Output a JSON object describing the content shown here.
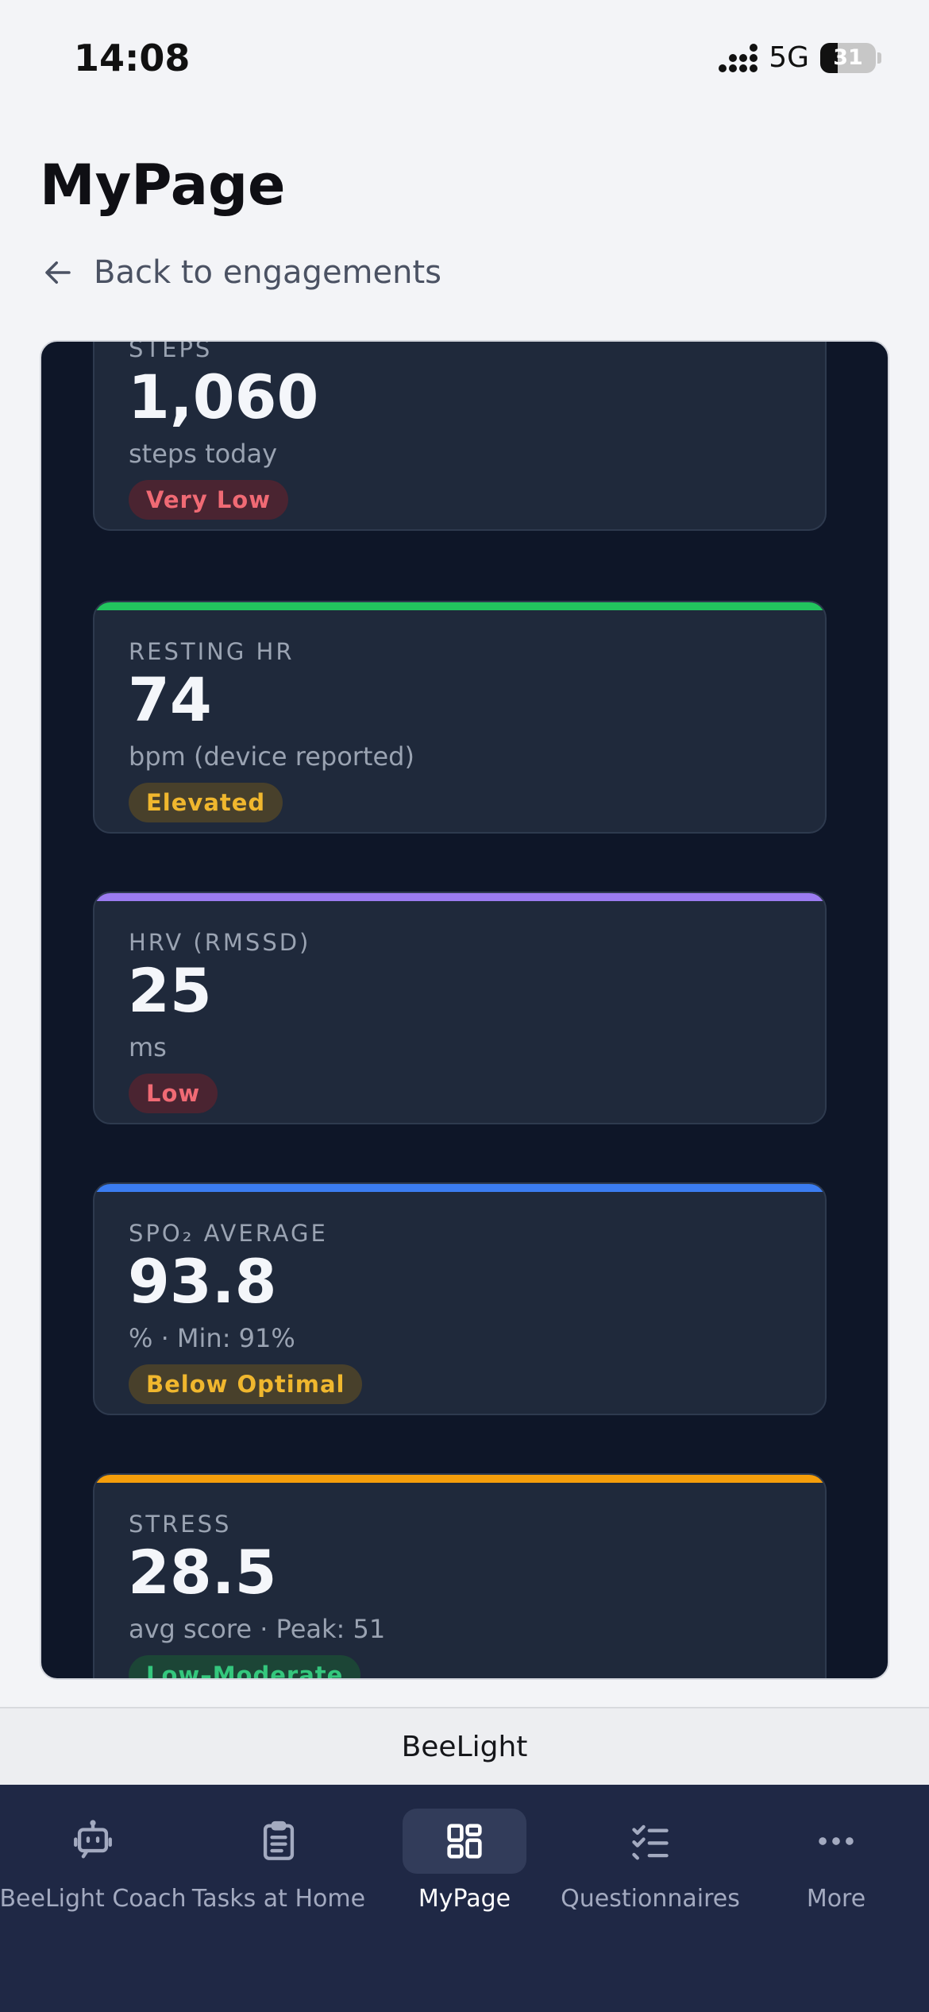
{
  "status_bar": {
    "time": "14:08",
    "network": "5G",
    "battery": "31"
  },
  "page": {
    "title": "MyPage",
    "back_label": "Back to engagements"
  },
  "colors": {
    "steps": "#22c55e",
    "resting_hr": "#22c55e",
    "hrv": "#9b7cf0",
    "spo2": "#3b7cf0",
    "stress": "#f59e0b"
  },
  "metrics": [
    {
      "label": "STEPS",
      "value": "1,060",
      "sub": "steps today",
      "badge": "Very Low",
      "badge_tone": "red"
    },
    {
      "label": "RESTING HR",
      "value": "74",
      "sub": "bpm (device reported)",
      "badge": "Elevated",
      "badge_tone": "amber"
    },
    {
      "label": "HRV (RMSSD)",
      "value": "25",
      "sub": "ms",
      "badge": "Low",
      "badge_tone": "red"
    },
    {
      "label": "SPO₂ AVERAGE",
      "value": "93.8",
      "sub": "%  ·  Min: 91%",
      "badge": "Below Optimal",
      "badge_tone": "amber"
    },
    {
      "label": "STRESS",
      "value": "28.5",
      "sub": "avg score  ·  Peak: 51",
      "badge": "Low–Moderate",
      "badge_tone": "green"
    }
  ],
  "footer": {
    "app_name": "BeeLight"
  },
  "tabs": [
    {
      "label": "BeeLight Coach",
      "icon": "robot-icon",
      "active": false
    },
    {
      "label": "Tasks at Home",
      "icon": "clipboard-icon",
      "active": false
    },
    {
      "label": "MyPage",
      "icon": "grid-icon",
      "active": true
    },
    {
      "label": "Questionnaires",
      "icon": "checklist-icon",
      "active": false
    },
    {
      "label": "More",
      "icon": "more-icon",
      "active": false
    }
  ]
}
